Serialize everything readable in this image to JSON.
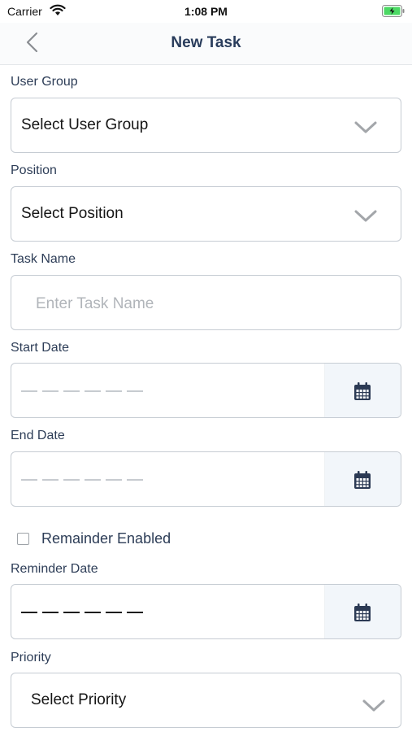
{
  "status_bar": {
    "carrier": "Carrier",
    "time": "1:08 PM"
  },
  "nav": {
    "title": "New Task"
  },
  "form": {
    "user_group": {
      "label": "User Group",
      "value": "Select User Group"
    },
    "position": {
      "label": "Position",
      "value": "Select Position"
    },
    "task_name": {
      "label": "Task Name",
      "placeholder": "Enter Task Name"
    },
    "start_date": {
      "label": "Start Date"
    },
    "end_date": {
      "label": "End Date"
    },
    "reminder_toggle": {
      "label": "Remainder Enabled",
      "checked": false
    },
    "reminder_date": {
      "label": "Reminder Date"
    },
    "priority": {
      "label": "Priority",
      "value": "Select Priority"
    }
  },
  "colors": {
    "accent": "#2a3d5c",
    "label": "#2d3d57",
    "border": "#c6ccd3",
    "calendar_bg": "#f2f6fa"
  },
  "icons": [
    "wifi-icon",
    "battery-icon",
    "back-chevron-icon",
    "chevron-down-icon",
    "calendar-icon"
  ]
}
